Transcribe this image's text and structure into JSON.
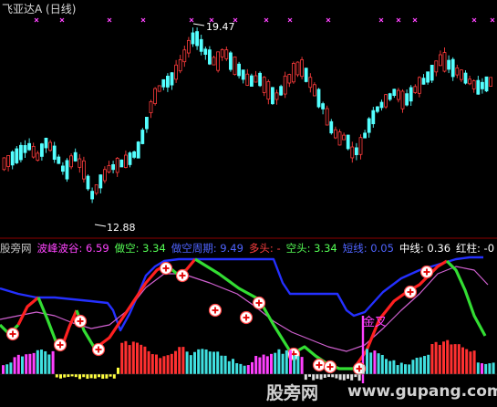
{
  "header": {
    "title": "飞亚达A (日线)",
    "high_label": "19.47",
    "low_label": "12.88"
  },
  "indicator": {
    "items": [
      {
        "label": "股旁网",
        "value": "",
        "color": "#c8c8c8"
      },
      {
        "label": "波峰波谷:",
        "value": "6.59",
        "color": "#ff44ff"
      },
      {
        "label": "做空:",
        "value": "3.34",
        "color": "#55ff55"
      },
      {
        "label": "做空周期:",
        "value": "9.49",
        "color": "#4f64ff"
      },
      {
        "label": "多头:",
        "value": "-",
        "color": "#ff4040"
      },
      {
        "label": "空头:",
        "value": "3.34",
        "color": "#55ff55"
      },
      {
        "label": "短线:",
        "value": "0.05",
        "color": "#4f64ff"
      },
      {
        "label": "中线:",
        "value": "0.36",
        "color": "#ffffff"
      },
      {
        "label": "红柱:",
        "value": "-0",
        "color": "#ffffff"
      }
    ]
  },
  "annotations": {
    "cross_text": "金叉"
  },
  "watermark": {
    "site_cn": "股旁网",
    "site_url": "www.gupang.com"
  },
  "colors": {
    "up_candle": "#ff3c3c",
    "down_candle": "#54ffff",
    "marker": "#ff44ff",
    "long_line": "#ff2020",
    "short_line": "#33dd33",
    "period_line": "#2430ff",
    "ma_line": "#d060d0"
  }
}
